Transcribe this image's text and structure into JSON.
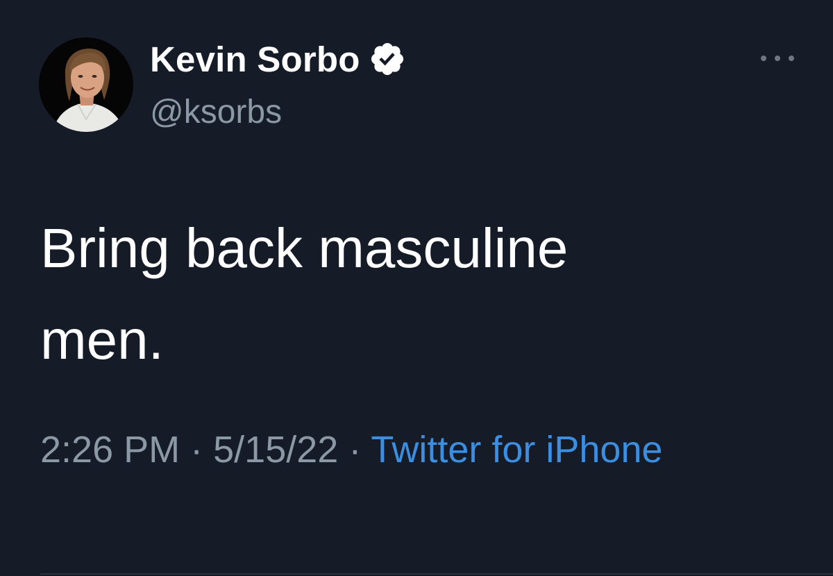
{
  "tweet": {
    "author": {
      "display_name": "Kevin Sorbo",
      "handle": "@ksorbs",
      "verified": true,
      "avatar_icon": "profile-photo"
    },
    "text": "Bring back masculine\nmen.",
    "time": "2:26 PM",
    "separator": "·",
    "date": "5/15/22",
    "source": "Twitter for iPhone"
  },
  "colors": {
    "background": "#161c27",
    "text_primary": "#ffffff",
    "text_secondary": "#8b98a5",
    "link": "#3b8fe3",
    "verified_badge": "#ffffff"
  },
  "icons": {
    "verified": "verified-badge-icon",
    "more": "more-options-icon"
  }
}
